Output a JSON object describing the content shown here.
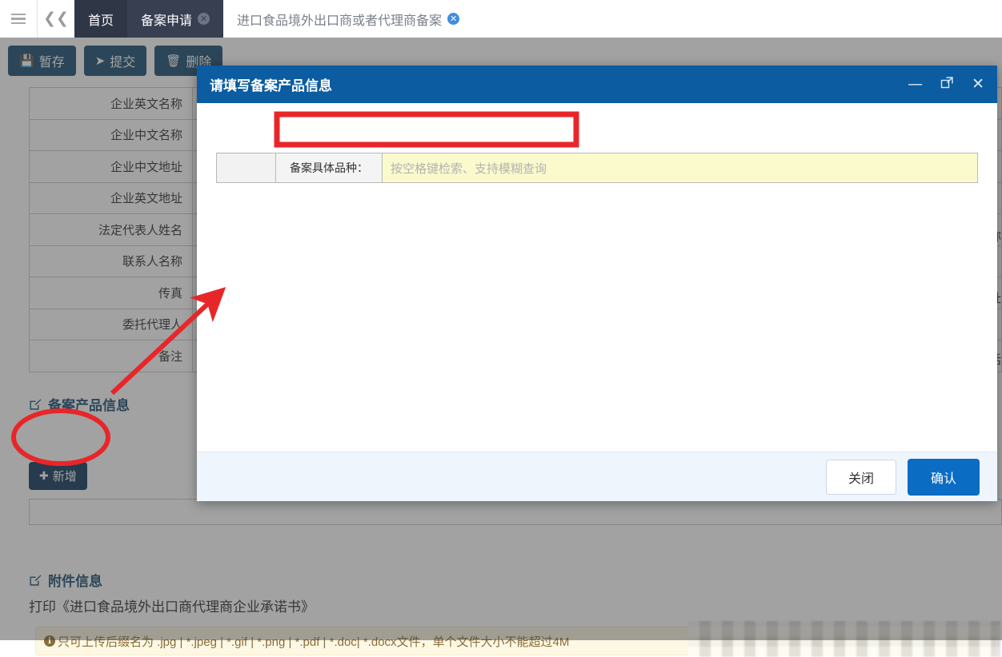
{
  "tabbar": {
    "menu_icon": "hamburger-icon",
    "collapse_icon": "double-chevron-left-icon",
    "tabs": [
      {
        "label": "首页",
        "closable": false,
        "state": "home"
      },
      {
        "label": "备案申请",
        "closable": true,
        "state": "inactive"
      },
      {
        "label": "进口食品境外出口商或者代理商备案",
        "closable": true,
        "state": "active"
      }
    ],
    "close_glyph": "✕"
  },
  "toolbar": {
    "buttons": [
      {
        "label": "暂存",
        "icon": "save-icon",
        "glyph": "💾"
      },
      {
        "label": "提交",
        "icon": "send-icon",
        "glyph": "➤"
      },
      {
        "label": "删除",
        "icon": "trash-icon",
        "glyph": "🗑"
      }
    ]
  },
  "form": {
    "rows": [
      {
        "label": "企业英文名称",
        "value": ""
      },
      {
        "label": "企业中文名称",
        "value": ""
      },
      {
        "label": "企业中文地址",
        "value": ""
      },
      {
        "label": "企业英文地址",
        "value": ""
      },
      {
        "label": "法定代表人姓名",
        "value": ""
      },
      {
        "label": "联系人名称",
        "value": ""
      },
      {
        "label": "传真",
        "value": ""
      },
      {
        "label": "委托代理人",
        "value": ""
      },
      {
        "label": "备注",
        "value": ""
      }
    ],
    "right_clipped": [
      "称",
      "址",
      "话"
    ]
  },
  "product_section": {
    "heading": "备案产品信息",
    "heading_icon": "edit-square-icon",
    "add_button": {
      "label": "新增",
      "icon": "plus-icon",
      "glyph": "✚"
    }
  },
  "attachment_section": {
    "heading": "附件信息",
    "heading_icon": "edit-square-icon",
    "print_line": "打印《进口食品境外出口商代理商企业承诺书》",
    "warning": "只可上传后缀名为 .jpg | *.jpeg | *.gif | *.png | *.pdf | *.doc| *.docx文件，单个文件大小不能超过4M",
    "warning_icon": "info-circle-icon",
    "warning_glyph": "i"
  },
  "modal": {
    "title": "请填写备案产品信息",
    "controls": [
      {
        "name": "minimize-icon",
        "glyph": "—"
      },
      {
        "name": "maximize-icon",
        "glyph": "⛶"
      },
      {
        "name": "close-icon",
        "glyph": "✕"
      }
    ],
    "field": {
      "label": "备案具体品种：",
      "value": "",
      "placeholder": "按空格键检索、支持模糊查询"
    },
    "footer": {
      "close_label": "关闭",
      "confirm_label": "确认"
    }
  },
  "annotations": {
    "highlight_color": "#e8262a",
    "ellipse_target": "add-button",
    "rect_target": "modal-product-field",
    "arrow": "from-add-button-to-modal-field"
  },
  "colors": {
    "tabbar_bg": "#373f51",
    "modal_header": "#0b5ca0",
    "primary_button": "#0b6cc4",
    "toolbar_button": "#1b4f72",
    "field_yellow": "#fafacd",
    "warning_bg": "#fcf8e3"
  }
}
